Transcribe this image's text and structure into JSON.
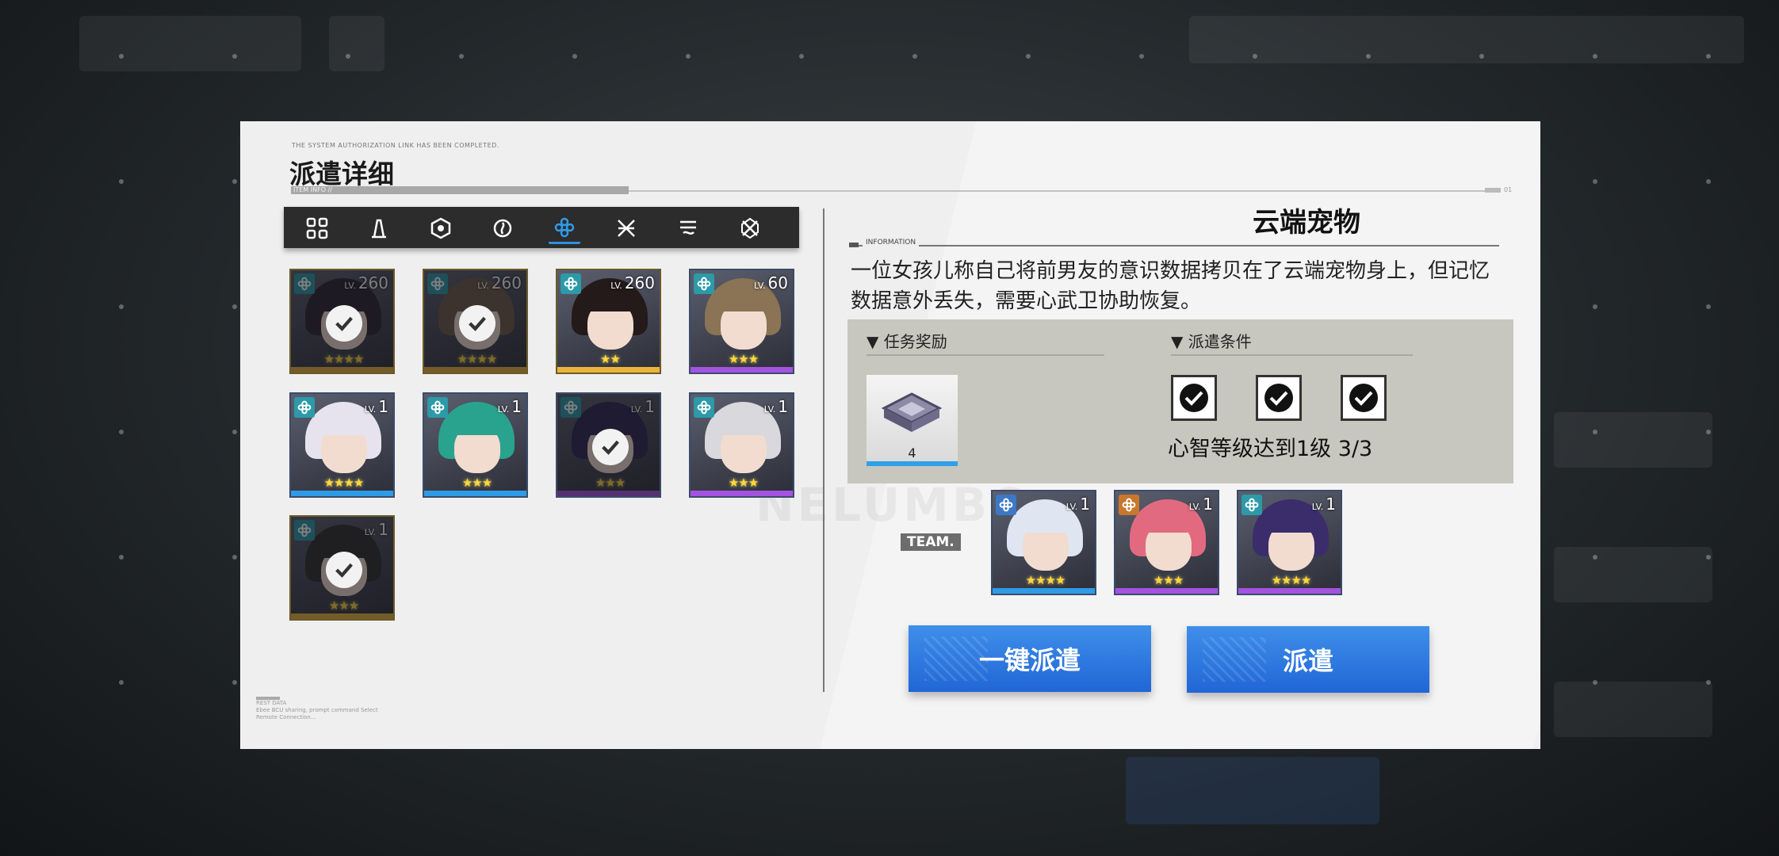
{
  "header": {
    "sys_text": "THE SYSTEM AUTHORIZATION LINK HAS BEEN COMPLETED.",
    "title": "派遣详细",
    "subtitle": "ITEM INFO //"
  },
  "filters": [
    {
      "name": "all",
      "icon": "grid-icon",
      "color": "#2c2c2c"
    },
    {
      "name": "class-1",
      "icon": "tower-icon",
      "color": "#b5302f"
    },
    {
      "name": "class-2",
      "icon": "hexagon-icon",
      "color": "#3b78c8"
    },
    {
      "name": "class-3",
      "icon": "flame-icon",
      "color": "#c8772c"
    },
    {
      "name": "class-4",
      "icon": "clover-icon",
      "color": "#2c2c2c",
      "selected": true
    },
    {
      "name": "class-5",
      "icon": "cross-blades-icon",
      "color": "#c89c2e"
    },
    {
      "name": "class-6",
      "icon": "wave-icon",
      "color": "#7b3ab4"
    },
    {
      "name": "class-7",
      "icon": "shield-x-icon",
      "color": "#8a9c34"
    }
  ],
  "roster": [
    {
      "lv_prefix": "LV.",
      "level": "260",
      "dispatched": true,
      "rarity": "gold",
      "hair": "#2b2230",
      "stars": "★★★★"
    },
    {
      "lv_prefix": "LV.",
      "level": "260",
      "dispatched": true,
      "rarity": "gold",
      "hair": "#6e5a48",
      "stars": "★★★★"
    },
    {
      "lv_prefix": "LV.",
      "level": "260",
      "dispatched": false,
      "rarity": "gold",
      "hair": "#241a1a",
      "stars": "★★"
    },
    {
      "lv_prefix": "LV.",
      "level": "60",
      "dispatched": false,
      "rarity": "purple",
      "hair": "#8a7455",
      "stars": "★★★"
    },
    {
      "lv_prefix": "LV.",
      "level": "1",
      "dispatched": false,
      "rarity": "blue",
      "hair": "#e6e3ee",
      "stars": "★★★★"
    },
    {
      "lv_prefix": "LV.",
      "level": "1",
      "dispatched": false,
      "rarity": "blue",
      "hair": "#2aa38e",
      "stars": "★★★"
    },
    {
      "lv_prefix": "LV.",
      "level": "1",
      "dispatched": true,
      "rarity": "purple",
      "hair": "#2a2450",
      "stars": "★★★"
    },
    {
      "lv_prefix": "LV.",
      "level": "1",
      "dispatched": false,
      "rarity": "purple",
      "hair": "#d8d8dd",
      "stars": "★★★"
    },
    {
      "lv_prefix": "LV.",
      "level": "1",
      "dispatched": true,
      "rarity": "gold",
      "hair": "#2e2e2e",
      "stars": "★★★"
    }
  ],
  "mission": {
    "title": "云端宠物",
    "info_label": "INFORMATION",
    "description": "一位女孩儿称自己将前男友的意识数据拷贝在了云端宠物身上，但记忆数据意外丢失，需要心武卫协助恢复。",
    "reward_header": "▼ 任务奖励",
    "reward_count": "4",
    "condition_header": "▼ 派遣条件",
    "condition_text": "心智等级达到1级 3/3"
  },
  "team": [
    {
      "lv_prefix": "LV.",
      "level": "1",
      "rarity": "blue",
      "hair": "#dfe6f2",
      "cls_color": "#3b78c8",
      "stars": "★★★★"
    },
    {
      "lv_prefix": "LV.",
      "level": "1",
      "rarity": "purple",
      "hair": "#e26a80",
      "cls_color": "#c8772c",
      "stars": "★★★"
    },
    {
      "lv_prefix": "LV.",
      "level": "1",
      "rarity": "purple",
      "hair": "#3b2d6b",
      "cls_color": "#2c9aa8",
      "stars": "★★★★"
    }
  ],
  "buttons": {
    "quick_dispatch": "一键派遣",
    "dispatch": "派遣"
  },
  "watermark": "NELUMBO",
  "team_tag": "TEAM.",
  "footer": {
    "label": "REST DATA",
    "line1": "Ebee BCU sharing, prompt command Select",
    "line2": "Remote Connection..."
  },
  "rarity_colors": {
    "gold": "#e9b43a",
    "purple": "#a453e0",
    "blue": "#2f9be6"
  }
}
